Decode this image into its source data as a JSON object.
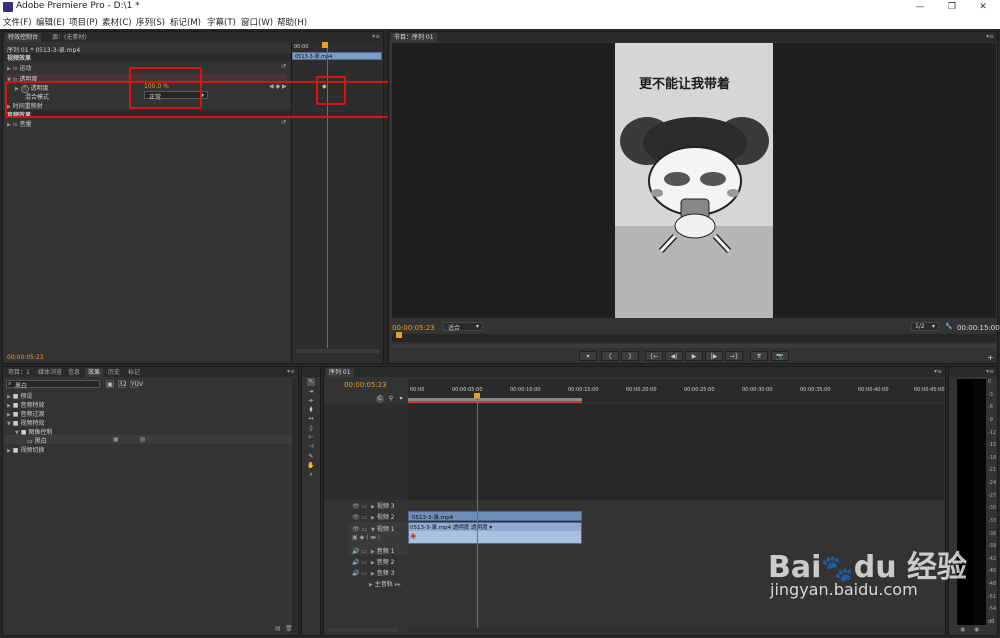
{
  "window": {
    "title": "Adobe Premiere Pro - D:\\1 *",
    "minimize": "—",
    "maximize": "❐",
    "close": "✕"
  },
  "menu": [
    "文件(F)",
    "编辑(E)",
    "项目(P)",
    "素材(C)",
    "序列(S)",
    "标记(M)",
    "字幕(T)",
    "窗口(W)",
    "帮助(H)"
  ],
  "effect_controls": {
    "tab_active": "特效控制台",
    "tab_2": "源：(无素材)",
    "clip_label": "序列 01 * 0513-3-录.mp4",
    "section_video": "视频效果",
    "motion": "运动",
    "opacity_group": "透明度",
    "opacity_label": "透明度",
    "opacity_value": "100.0 %",
    "blend_label": "混合模式",
    "blend_value": "正常",
    "time_remap": "时间重映射",
    "audio_effects": "音频效果",
    "volume": "音量",
    "timecode": "00:00:05:23",
    "mini_clip": "0513-3-录.mp4",
    "mini_time": "00:00"
  },
  "program": {
    "tab": "节目：序列 01",
    "caption": "更不能让我带着",
    "timecode": "00:00:05:23",
    "fit": "适合",
    "ratio": "1/2",
    "duration": "00:00:15:00"
  },
  "project": {
    "tabs": [
      "项目：1",
      "媒体浏览",
      "信息",
      "效果",
      "历史",
      "标记"
    ],
    "search_value": "黑白",
    "tree": [
      {
        "label": "预设",
        "indent": 0
      },
      {
        "label": "音频特效",
        "indent": 0
      },
      {
        "label": "音频过渡",
        "indent": 0
      },
      {
        "label": "视频特效",
        "indent": 0
      },
      {
        "label": "图像控制",
        "indent": 1
      },
      {
        "label": "黑白",
        "indent": 2
      },
      {
        "label": "视频切换",
        "indent": 0
      }
    ]
  },
  "timeline": {
    "tab": "序列 01",
    "timecode": "00:00:05:23",
    "ruler": [
      "00:00",
      "00:00:05:00",
      "00:00:10:00",
      "00:00:15:00",
      "00:00:20:00",
      "00:00:25:00",
      "00:00:30:00",
      "00:00:35:00",
      "00:00:40:00",
      "00:00:45:00"
    ],
    "tracks": {
      "v3": "视频 3",
      "v2": "视频 2",
      "v1": "视频 1",
      "a1": "音频 1",
      "a2": "音频 2",
      "a3": "音频 3",
      "master": "主音轨"
    },
    "clip_v2": "0513-3-录.mp4",
    "clip_v1": "0513-3-录.mp4  透明度:透明度 ▾"
  },
  "meter_scale": [
    "0",
    "-3",
    "-6",
    "-9",
    "-12",
    "-15",
    "-18",
    "-21",
    "-24",
    "-27",
    "-30",
    "-33",
    "-36",
    "-39",
    "-42",
    "-45",
    "-48",
    "-51",
    "-54",
    "dB"
  ],
  "watermark": {
    "logo": "Bai du 经验",
    "url": "jingyan.baidu.com"
  },
  "colors": {
    "accent": "#e8a11f",
    "highlight": "#e01010",
    "clip_blue": "#7d9bc4"
  }
}
